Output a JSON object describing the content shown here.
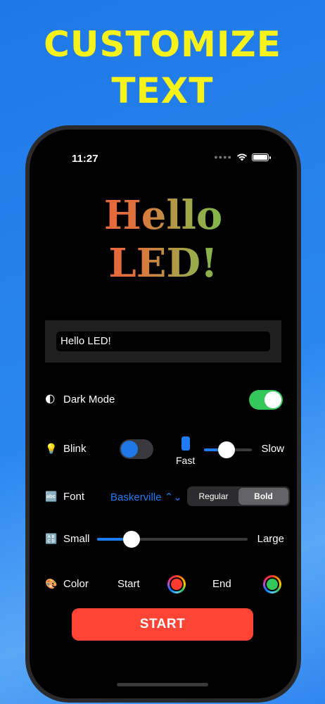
{
  "promo": {
    "line1": "CUSTOMIZE",
    "line2": "TEXT"
  },
  "status_bar": {
    "time": "11:27"
  },
  "preview": {
    "line1": "Hello",
    "line2": "LED!"
  },
  "text_input": {
    "value": "Hello LED!"
  },
  "dark_mode": {
    "emoji": "🌓",
    "label": "Dark Mode",
    "enabled": true
  },
  "blink": {
    "emoji": "💡",
    "label": "Blink",
    "enabled": false,
    "fast_label": "Fast",
    "slow_label": "Slow",
    "speed_fraction": 0.47
  },
  "font": {
    "emoji": "🔤",
    "label": "Font",
    "family": "Baskerville ⌃⌄",
    "styles": [
      "Regular",
      "Bold"
    ],
    "selected_style": "Bold"
  },
  "size": {
    "emoji": "🔠",
    "label": "Small",
    "large_label": "Large",
    "fraction": 0.23
  },
  "color": {
    "emoji": "🎨",
    "label": "Color",
    "start_label": "Start",
    "end_label": "End",
    "start_color": "#ff3b30",
    "end_color": "#34c759"
  },
  "start_button": {
    "label": "START"
  },
  "colors": {
    "accent": "#1e7cf2",
    "toggle_on": "#34c759",
    "start_button": "#ff4436",
    "headline": "#f7f31a"
  }
}
